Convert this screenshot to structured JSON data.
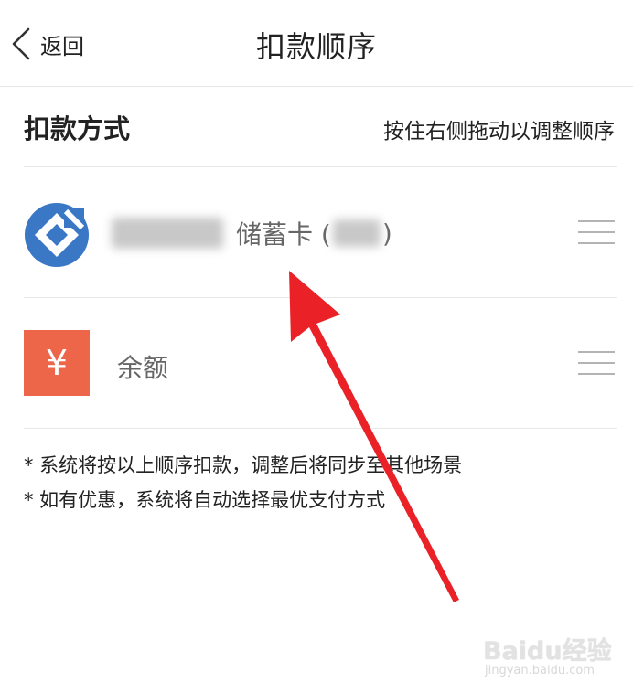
{
  "nav": {
    "back_label": "返回",
    "title": "扣款顺序",
    "back_icon": "chevron-left-icon"
  },
  "section": {
    "title": "扣款方式",
    "hint": "按住右侧拖动以调整顺序"
  },
  "payment_methods": [
    {
      "icon": "bank-logo-icon",
      "label_visible": "储蓄卡 (",
      "label_close": ")",
      "redacted_prefix": true,
      "redacted_tail": true,
      "brand_color": "#3a78c6"
    },
    {
      "icon": "yuan-icon",
      "icon_glyph": "¥",
      "label": "余额",
      "brand_color": "#ee6649"
    }
  ],
  "notes": [
    "* 系统将按以上顺序扣款，调整后将同步至其他场景",
    "* 如有优惠，系统将自动选择最优支付方式"
  ],
  "annotation": {
    "type": "arrow",
    "color": "#ea2228"
  },
  "watermark": {
    "text": "Baidu经验",
    "url": "jingyan.baidu.com"
  }
}
